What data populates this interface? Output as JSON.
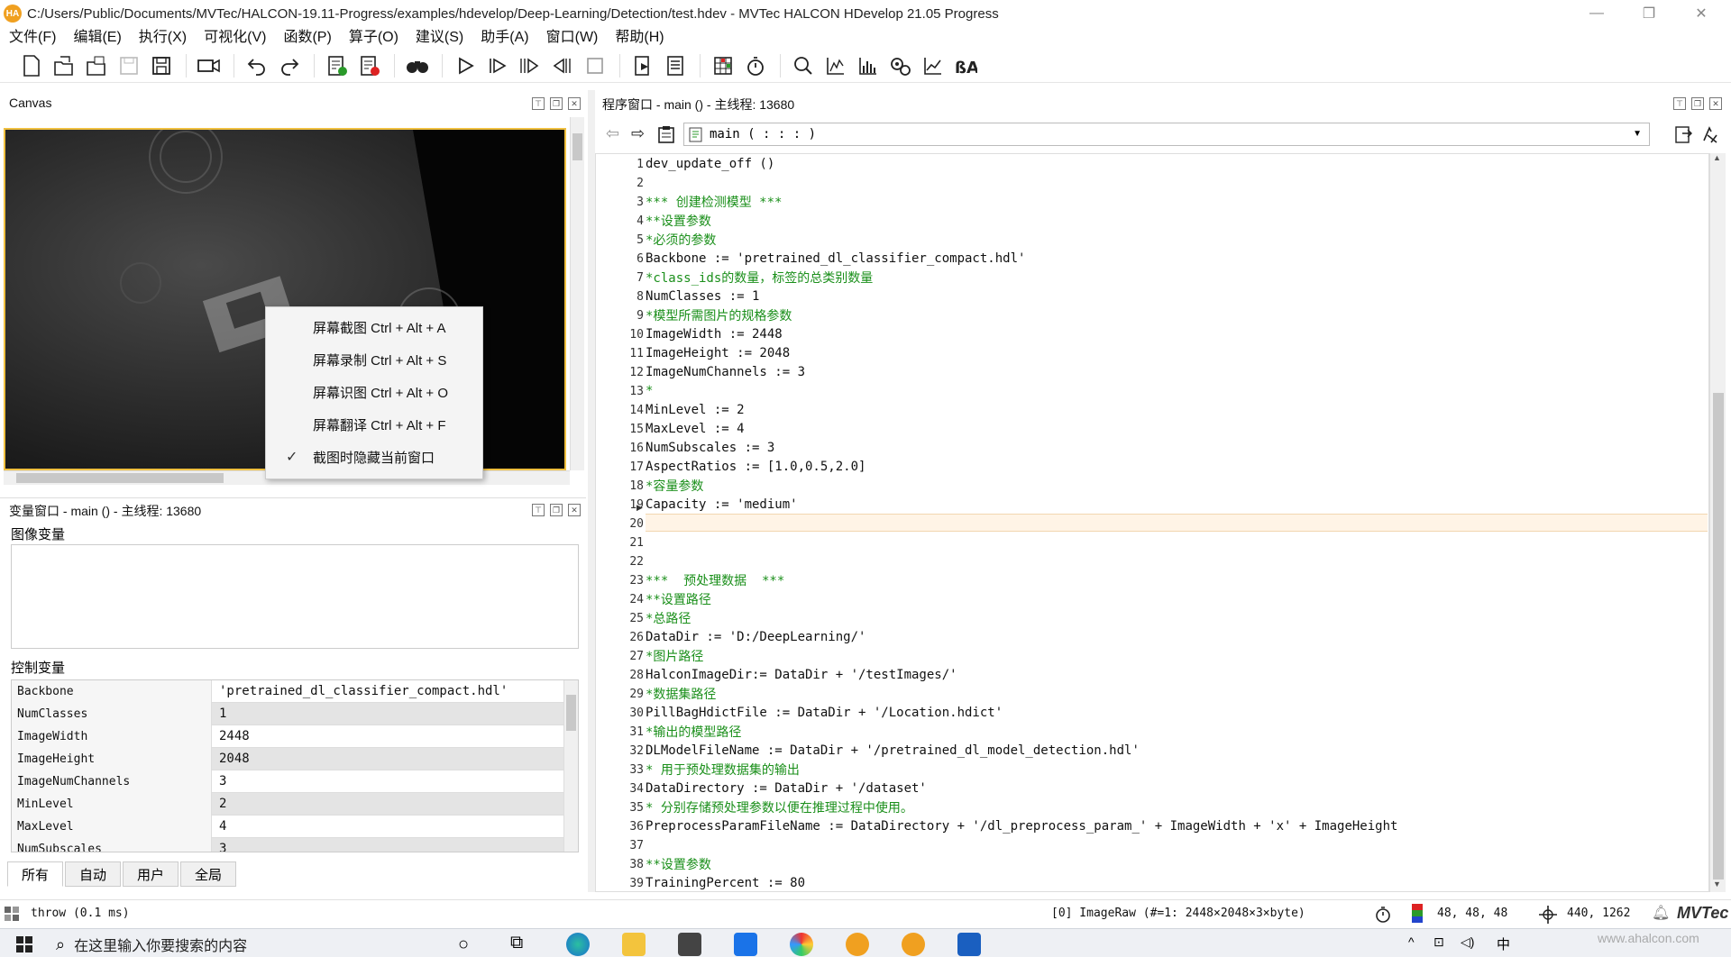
{
  "window": {
    "logo_text": "HA",
    "title": "C:/Users/Public/Documents/MVTec/HALCON-19.11-Progress/examples/hdevelop/Deep-Learning/Detection/test.hdev - MVTec HALCON HDevelop 21.05 Progress"
  },
  "menu": [
    "文件(F)",
    "编辑(E)",
    "执行(X)",
    "可视化(V)",
    "函数(P)",
    "算子(O)",
    "建议(S)",
    "助手(A)",
    "窗口(W)",
    "帮助(H)"
  ],
  "canvas": {
    "title": "Canvas"
  },
  "context_menu": {
    "items": [
      {
        "label": "屏幕截图 Ctrl + Alt + A",
        "checked": false
      },
      {
        "label": "屏幕录制 Ctrl + Alt + S",
        "checked": false
      },
      {
        "label": "屏幕识图 Ctrl + Alt + O",
        "checked": false
      },
      {
        "label": "屏幕翻译 Ctrl + Alt + F",
        "checked": false
      },
      {
        "label": "截图时隐藏当前窗口",
        "checked": true
      }
    ],
    "check_glyph": "✓"
  },
  "variables": {
    "title": "变量窗口 - main () - 主线程: 13680",
    "image_vars_label": "图像变量",
    "control_vars_label": "控制变量",
    "rows": [
      {
        "name": "Backbone",
        "value": "'pretrained_dl_classifier_compact.hdl'"
      },
      {
        "name": "NumClasses",
        "value": "1"
      },
      {
        "name": "ImageWidth",
        "value": "2448"
      },
      {
        "name": "ImageHeight",
        "value": "2048"
      },
      {
        "name": "ImageNumChannels",
        "value": "3"
      },
      {
        "name": "MinLevel",
        "value": "2"
      },
      {
        "name": "MaxLevel",
        "value": "4"
      },
      {
        "name": "NumSubscales",
        "value": "3"
      }
    ],
    "tabs": [
      "所有",
      "自动",
      "用户",
      "全局"
    ]
  },
  "program": {
    "title": "程序窗口 - main () - 主线程: 13680",
    "procedure": "main ( : : : )",
    "lines": [
      {
        "n": "1",
        "text": "dev_update_off ()",
        "comment": false
      },
      {
        "n": "2",
        "text": "",
        "comment": false
      },
      {
        "n": "3",
        "text": "*** 创建检测模型 ***",
        "comment": true
      },
      {
        "n": "4",
        "text": "**设置参数",
        "comment": true
      },
      {
        "n": "5",
        "text": "*必须的参数",
        "comment": true
      },
      {
        "n": "6",
        "text": "Backbone := 'pretrained_dl_classifier_compact.hdl'",
        "comment": false
      },
      {
        "n": "7",
        "text": "*class_ids的数量，标签的总类别数量",
        "comment": true
      },
      {
        "n": "8",
        "text": "NumClasses := 1",
        "comment": false
      },
      {
        "n": "9",
        "text": "*模型所需图片的规格参数",
        "comment": true
      },
      {
        "n": "10",
        "text": "ImageWidth := 2448",
        "comment": false
      },
      {
        "n": "11",
        "text": "ImageHeight := 2048",
        "comment": false
      },
      {
        "n": "12",
        "text": "ImageNumChannels := 3",
        "comment": false
      },
      {
        "n": "13",
        "text": "*",
        "comment": true
      },
      {
        "n": "14",
        "text": "MinLevel := 2",
        "comment": false
      },
      {
        "n": "15",
        "text": "MaxLevel := 4",
        "comment": false
      },
      {
        "n": "16",
        "text": "NumSubscales := 3",
        "comment": false
      },
      {
        "n": "17",
        "text": "AspectRatios := [1.0,0.5,2.0]",
        "comment": false
      },
      {
        "n": "18",
        "text": "*容量参数",
        "comment": true
      },
      {
        "n": "19",
        "text": "Capacity := 'medium'",
        "comment": false
      },
      {
        "n": "20",
        "text": "",
        "comment": false
      },
      {
        "n": "21",
        "text": "",
        "comment": false
      },
      {
        "n": "22",
        "text": "",
        "comment": false
      },
      {
        "n": "23",
        "text": "***  预处理数据  ***",
        "comment": true
      },
      {
        "n": "24",
        "text": "**设置路径",
        "comment": true
      },
      {
        "n": "25",
        "text": "*总路径",
        "comment": true
      },
      {
        "n": "26",
        "text": "DataDir := 'D:/DeepLearning/'",
        "comment": false
      },
      {
        "n": "27",
        "text": "*图片路径",
        "comment": true
      },
      {
        "n": "28",
        "text": "HalconImageDir:= DataDir + '/testImages/'",
        "comment": false
      },
      {
        "n": "29",
        "text": "*数据集路径",
        "comment": true
      },
      {
        "n": "30",
        "text": "PillBagHdictFile := DataDir + '/Location.hdict'",
        "comment": false
      },
      {
        "n": "31",
        "text": "*输出的模型路径",
        "comment": true
      },
      {
        "n": "32",
        "text": "DLModelFileName := DataDir + '/pretrained_dl_model_detection.hdl'",
        "comment": false
      },
      {
        "n": "33",
        "text": "* 用于预处理数据集的输出",
        "comment": true
      },
      {
        "n": "34",
        "text": "DataDirectory := DataDir + '/dataset'",
        "comment": false
      },
      {
        "n": "35",
        "text": "* 分别存储预处理参数以便在推理过程中使用。",
        "comment": true
      },
      {
        "n": "36",
        "text": "PreprocessParamFileName := DataDirectory + '/dl_preprocess_param_' + ImageWidth + 'x' + ImageHeight",
        "comment": false
      },
      {
        "n": "37",
        "text": "",
        "comment": false
      },
      {
        "n": "38",
        "text": "**设置参数",
        "comment": true
      },
      {
        "n": "39",
        "text": "TrainingPercent := 80",
        "comment": false
      }
    ]
  },
  "status": {
    "left": "throw (0.1 ms)",
    "image_info": "[0] ImageRaw (#=1: 2448×2048×3×byte)",
    "pixel": "48, 48, 48",
    "coords": "440, 1262",
    "brand": "MVTec"
  },
  "taskbar": {
    "search_placeholder": "在这里输入你要搜索的内容",
    "ime": "中",
    "watermark": "www.ahalcon.com"
  },
  "colors": {
    "comment": "#1a8f1a",
    "highlight_line": "#fff4e6",
    "canvas_border": "#f0c040"
  }
}
